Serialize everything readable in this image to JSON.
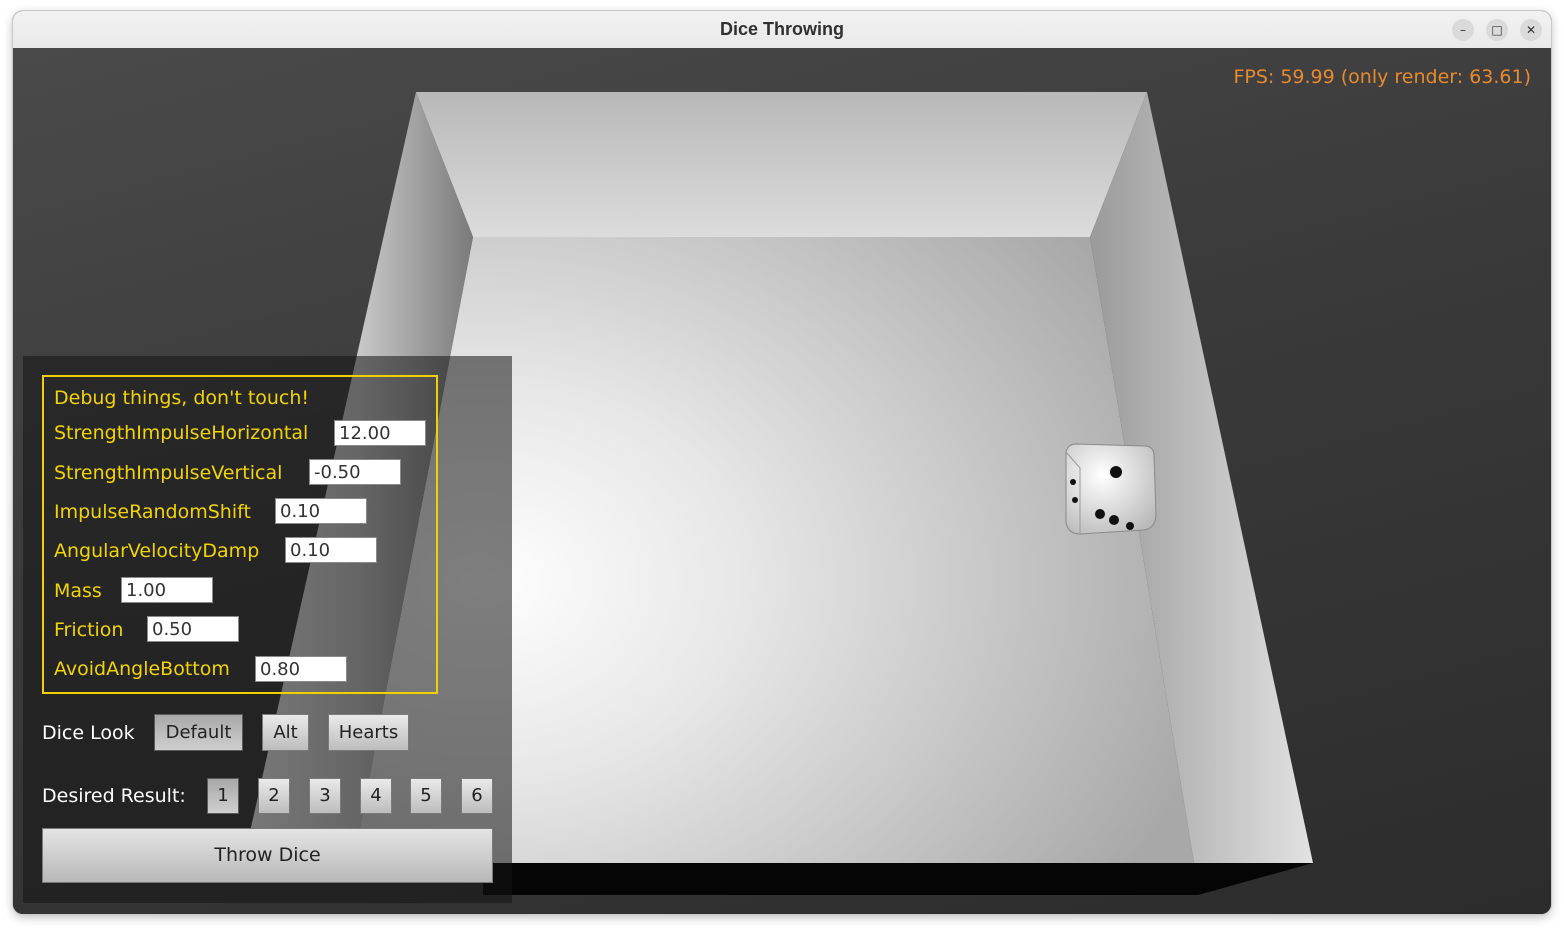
{
  "window": {
    "title": "Dice Throwing",
    "controls": {
      "minimize_icon": "–",
      "maximize_icon": "□",
      "close_icon": "✕"
    }
  },
  "hud": {
    "fps_text": "FPS: 59.99 (only render: 63.61)"
  },
  "debug": {
    "title": "Debug things, don't touch!",
    "fields": [
      {
        "label": "StrengthImpulseHorizontal",
        "value": "12.00"
      },
      {
        "label": "StrengthImpulseVertical",
        "value": "-0.50"
      },
      {
        "label": "ImpulseRandomShift",
        "value": "0.10"
      },
      {
        "label": "AngularVelocityDamp",
        "value": "0.10"
      },
      {
        "label": "Mass",
        "value": "1.00"
      },
      {
        "label": "Friction",
        "value": "0.50"
      },
      {
        "label": "AvoidAngleBottom",
        "value": "0.80"
      }
    ]
  },
  "dice_look": {
    "label": "Dice Look",
    "options": [
      "Default",
      "Alt",
      "Hearts"
    ],
    "selected": "Default"
  },
  "desired_result": {
    "label": "Desired Result:",
    "options": [
      "1",
      "2",
      "3",
      "4",
      "5",
      "6"
    ],
    "selected": "1"
  },
  "throw_button": {
    "label": "Throw Dice"
  },
  "colors": {
    "debug_accent": "#f2d400",
    "fps_text": "#e88a2e"
  }
}
